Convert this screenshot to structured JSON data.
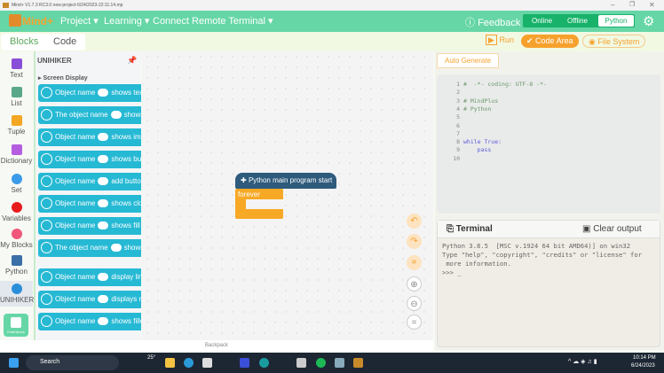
{
  "window": {
    "title": "Mind+ V1.7.3 RC3.0   new-project-6/24/2023-22:11:14.mp"
  },
  "menubar": {
    "logo": "Mind+",
    "items": [
      "Project",
      "Learning",
      "Connect Remote Terminal"
    ],
    "feedback": "Feedback",
    "modes": [
      "Online",
      "Offline",
      "Python"
    ]
  },
  "tabs": {
    "blocks": "Blocks",
    "code": "Code",
    "run": "Run",
    "code_area": "Code Area",
    "file_system": "File System"
  },
  "categories": [
    {
      "label": "Text",
      "color": "#8a4fd8"
    },
    {
      "label": "List",
      "color": "#5aa88a"
    },
    {
      "label": "Tuple",
      "color": "#f5a623"
    },
    {
      "label": "Dictionary",
      "color": "#b55de0"
    },
    {
      "label": "Set",
      "color": "#3b9be8"
    },
    {
      "label": "Variables",
      "color": "#e81c1c"
    },
    {
      "label": "My Blocks",
      "color": "#f0577a"
    },
    {
      "label": "Python",
      "color": "#3a6fa8"
    },
    {
      "label": "UNIHIKER",
      "color": "#2a8fd8"
    },
    {
      "label": "Extensions",
      "color": "#66d6a6"
    }
  ],
  "palette": {
    "title": "UNIHIKER",
    "section": "Screen Display",
    "blocks": [
      {
        "pre": "Object name",
        "post": "shows tex"
      },
      {
        "pre": "The object name",
        "post": "shows"
      },
      {
        "pre": "Object name",
        "post": "shows ima"
      },
      {
        "pre": "Object name",
        "post": "shows bui"
      },
      {
        "pre": "Object name",
        "post": "add butto"
      },
      {
        "pre": "Object name",
        "post": "shows clo"
      },
      {
        "pre": "Object name",
        "post": "shows fill"
      },
      {
        "pre": "The object name",
        "post": "shows"
      },
      {
        "pre": "Object name",
        "post": "display lin"
      },
      {
        "pre": "Object name",
        "post": "displays re"
      },
      {
        "pre": "Object name",
        "post": "shows fille"
      }
    ]
  },
  "canvas": {
    "hat": "Python main program start",
    "loop": "forever"
  },
  "code_panel": {
    "tab": "Auto Generate",
    "lines": [
      "#  -*- coding: UTF-8 -*-",
      "",
      "# MindPlus",
      "# Python",
      "",
      "",
      "",
      "while True:",
      "    pass",
      ""
    ]
  },
  "terminal": {
    "title": "Terminal",
    "clear": "Clear output",
    "output": "Python 3.8.5  [MSC v.1924 64 bit AMD64)] on win32\nType \"help\", \"copyright\", \"credits\" or \"license\" for\n more information.\n>>> _"
  },
  "backpack": "Backpack",
  "taskbar": {
    "search": "Search",
    "weather": "25°",
    "time": "10:14 PM",
    "date": "6/24/2023"
  }
}
